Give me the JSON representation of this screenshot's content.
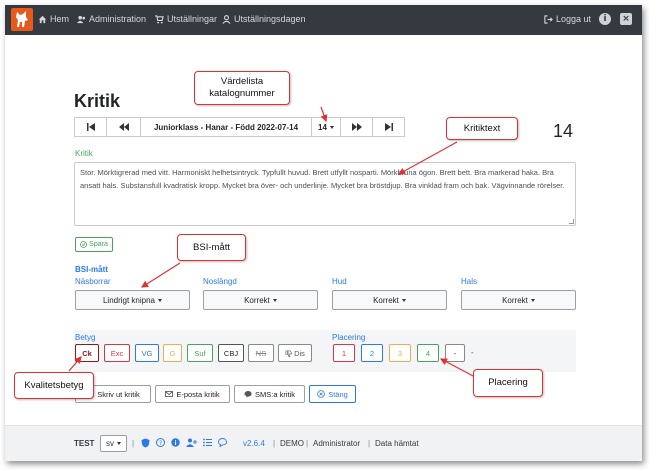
{
  "nav": {
    "home": "Hem",
    "administration": "Administration",
    "exhibitions": "Utställningar",
    "exhibition_day": "Utställningsdagen",
    "logout": "Logga ut",
    "info_icon": "i",
    "close_icon": "×"
  },
  "page": {
    "title": "Kritik",
    "current_number": "14"
  },
  "pager": {
    "first": "⏮",
    "prev": "⏪",
    "class_label": "Juniorklass - Hanar - Född 2022-07-14",
    "catalog_number": "14",
    "next": "⏩",
    "last": "⏭"
  },
  "critique": {
    "label": "Kritik",
    "text": "Stor. Mörktigrerad med vitt. Harmoniskt helhetsintryck. Typfullt huvud. Brett utfyllt nosparti. Mörkbruna ögon. Brett bett. Bra markerad haka. Bra ansatt hals. Substansfull kvadratisk kropp. Mycket bra över- och underlinje. Mycket bra bröstdjup. Bra vinklad fram och bak. Vägvinnande rörelser.",
    "save": "Spara"
  },
  "bsi": {
    "title": "BSI-mått",
    "fields": [
      {
        "label": "Näsborrar",
        "value": "Lindrigt knipna"
      },
      {
        "label": "Noslängd",
        "value": "Korrekt"
      },
      {
        "label": "Hud",
        "value": "Korrekt"
      },
      {
        "label": "Hals",
        "value": "Korrekt"
      }
    ]
  },
  "grades": {
    "label": "Betyg",
    "items": [
      "Ck",
      "Exc",
      "VG",
      "G",
      "Suf",
      "CBJ",
      "NS",
      "Dis"
    ]
  },
  "placement": {
    "label": "Placering",
    "items": [
      "1",
      "2",
      "3",
      "4",
      "-"
    ],
    "value": "-"
  },
  "actions": {
    "print": "Skriv ut kritik",
    "email": "E-posta kritik",
    "sms": "SMS:a kritik",
    "close": "Stäng"
  },
  "footer": {
    "env": "TEST",
    "lang": "sv",
    "version": "v2.6.4",
    "mode": "DEMO",
    "role": "Administrator",
    "status": "Data hämtat"
  },
  "annotations": {
    "catalog": "Värdelista katalognummer",
    "critique": "Kritiktext",
    "bsi": "BSI-mått",
    "quality": "Kvalitetsbetyg",
    "placement": "Placering"
  },
  "colors": {
    "navbar": "#343a40",
    "green": "#4aa35c",
    "blue": "#2c7be5",
    "annotation": "#e03131"
  }
}
